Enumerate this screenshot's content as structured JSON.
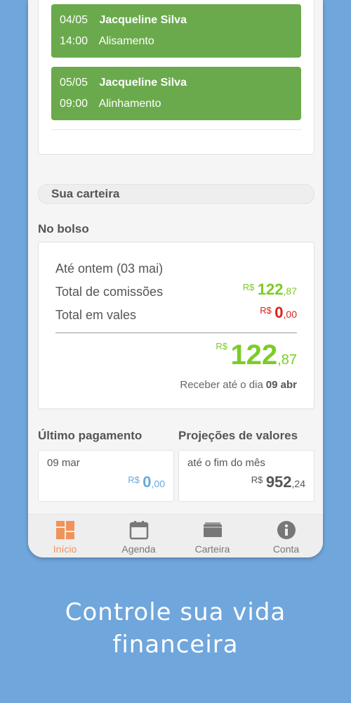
{
  "appointments": [
    {
      "date": "04/05",
      "client": "Jacqueline Silva",
      "time": "14:00",
      "service": "Alisamento"
    },
    {
      "date": "05/05",
      "client": "Jacqueline Silva",
      "time": "09:00",
      "service": "Alinhamento"
    }
  ],
  "wallet": {
    "section_title": "Sua carteira",
    "pocket_label": "No bolso",
    "period": "Até ontem (03 mai)",
    "commissions_label": "Total de comissões",
    "commissions": {
      "currency": "R$",
      "whole": "122",
      "cents": ",87"
    },
    "vouchers_label": "Total em vales",
    "vouchers": {
      "currency": "R$",
      "whole": "0",
      "cents": ",00"
    },
    "total": {
      "currency": "R$",
      "whole": "122",
      "cents": ",87"
    },
    "receive_text": "Receber até o dia",
    "receive_date": "09 abr"
  },
  "last_payment": {
    "title": "Último pagamento",
    "date": "09 mar",
    "amount": {
      "currency": "R$",
      "whole": "0",
      "cents": ",00"
    }
  },
  "projections": {
    "title": "Projeções de valores",
    "desc": "até o fim do mês",
    "amount": {
      "currency": "R$",
      "whole": "952",
      "cents": ",24"
    }
  },
  "tabs": [
    {
      "label": "Início",
      "icon": "dashboard-icon",
      "active": true
    },
    {
      "label": "Agenda",
      "icon": "calendar-icon",
      "active": false
    },
    {
      "label": "Carteira",
      "icon": "wallet-icon",
      "active": false
    },
    {
      "label": "Conta",
      "icon": "info-icon",
      "active": false
    }
  ],
  "caption": {
    "line1": "Controle sua vida",
    "line2": "financeira"
  },
  "colors": {
    "accent_green": "#6aaa4c",
    "money_green": "#7bcc25",
    "money_red": "#d9201a",
    "money_blue": "#66aadd",
    "tab_active": "#f0935a",
    "background": "#6fa6dc"
  }
}
